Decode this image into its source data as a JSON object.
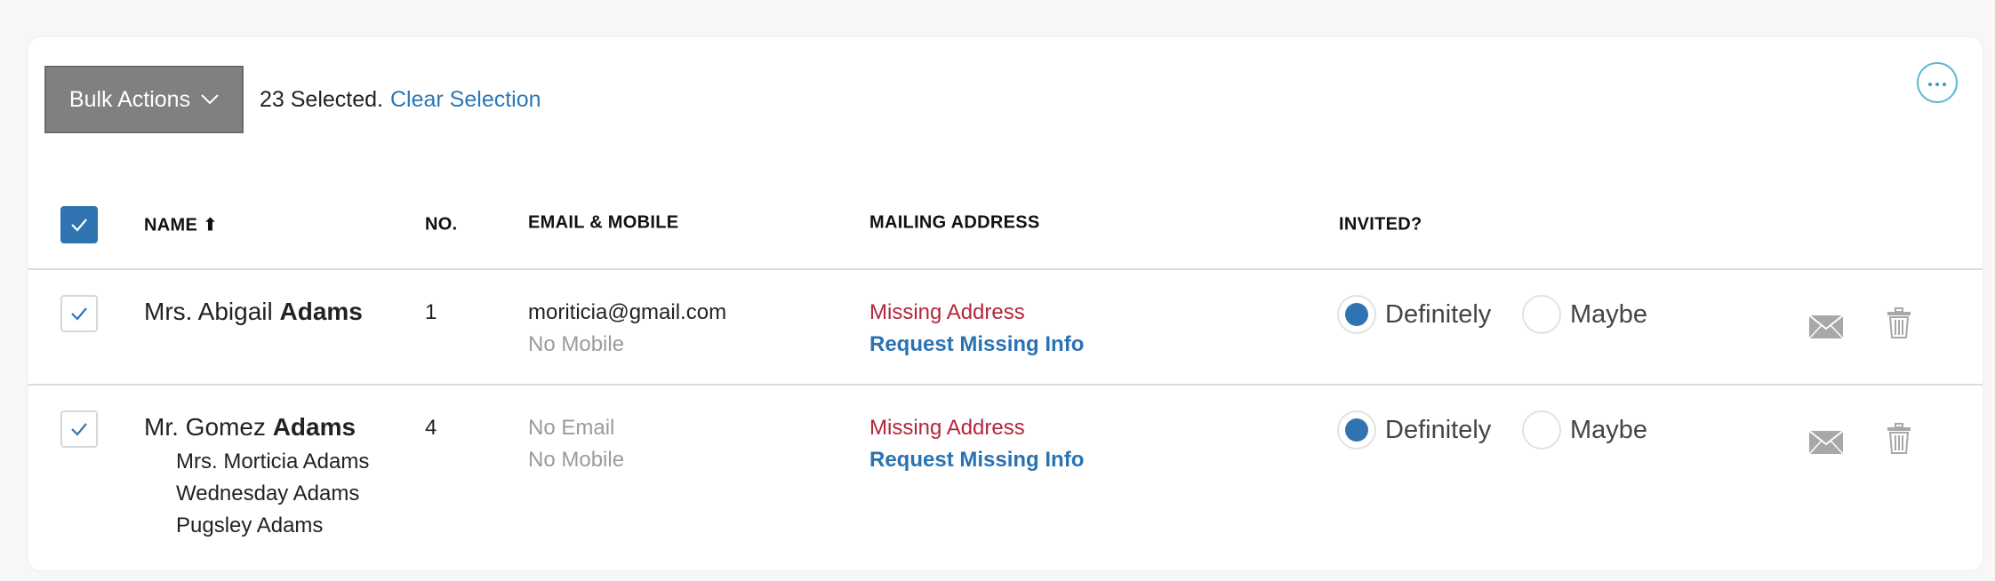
{
  "toolbar": {
    "bulk_actions_label": "Bulk Actions",
    "selected_text": "23 Selected.",
    "clear_selection_label": "Clear Selection"
  },
  "table": {
    "columns": {
      "name": "NAME ⬆",
      "no": "NO.",
      "email_mobile": "EMAIL & MOBILE",
      "mailing_address": "MAILING ADDRESS",
      "invited": "INVITED?"
    },
    "select_all_checked": true,
    "rows": [
      {
        "checked": true,
        "name_prefix": "Mrs. Abigail ",
        "name_last": "Adams",
        "members": [],
        "no": "1",
        "email": "moriticia@gmail.com",
        "mobile": "No Mobile",
        "address": "Missing Address",
        "request_label": "Request Missing Info",
        "invited_options": [
          "Definitely",
          "Maybe"
        ],
        "invited_selected": "Definitely"
      },
      {
        "checked": true,
        "name_prefix": "Mr. Gomez ",
        "name_last": "Adams",
        "members": [
          "Mrs. Morticia Adams",
          "Wednesday Adams",
          "Pugsley Adams"
        ],
        "no": "4",
        "email": "No Email",
        "mobile": "No Mobile",
        "address": "Missing Address",
        "request_label": "Request Missing Info",
        "invited_options": [
          "Definitely",
          "Maybe"
        ],
        "invited_selected": "Definitely"
      }
    ]
  },
  "icons": {
    "more": "ellipsis-icon",
    "email": "envelope-icon",
    "delete": "trash-icon",
    "check": "check-icon",
    "dropdown": "chevron-down-icon"
  },
  "colors": {
    "accent_blue": "#2f74b0",
    "link_blue": "#2b77b8",
    "missing_red": "#b3263c",
    "bulk_gray": "#808080"
  }
}
